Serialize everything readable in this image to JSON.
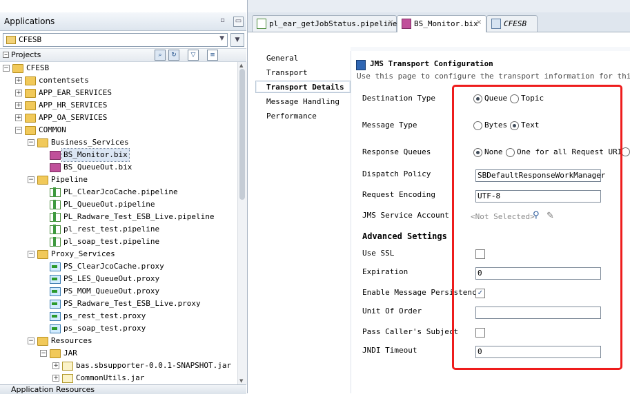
{
  "left_panel": {
    "applications_title": "Applications",
    "minimize_glyph": "▭",
    "app_selector_value": "CFESB",
    "projects_title": "Projects",
    "tree": [
      {
        "label": "CFESB",
        "level": 0,
        "type": "folder",
        "expander": "−"
      },
      {
        "label": "contentsets",
        "level": 1,
        "type": "folder",
        "expander": "+"
      },
      {
        "label": "APP_EAR_SERVICES",
        "level": 1,
        "type": "folder",
        "expander": "+"
      },
      {
        "label": "APP_HR_SERVICES",
        "level": 1,
        "type": "folder",
        "expander": "+"
      },
      {
        "label": "APP_OA_SERVICES",
        "level": 1,
        "type": "folder",
        "expander": "+"
      },
      {
        "label": "COMMON",
        "level": 1,
        "type": "folder",
        "expander": "−"
      },
      {
        "label": "Business_Services",
        "level": 2,
        "type": "folder",
        "expander": "−"
      },
      {
        "label": "BS_Monitor.bix",
        "level": 3,
        "type": "biz",
        "selected": true
      },
      {
        "label": "BS_QueueOut.bix",
        "level": 3,
        "type": "biz"
      },
      {
        "label": "Pipeline",
        "level": 2,
        "type": "folder",
        "expander": "−"
      },
      {
        "label": "PL_ClearJcoCache.pipeline",
        "level": 3,
        "type": "pipe"
      },
      {
        "label": "PL_QueueOut.pipeline",
        "level": 3,
        "type": "pipe"
      },
      {
        "label": "PL_Radware_Test_ESB_Live.pipeline",
        "level": 3,
        "type": "pipe"
      },
      {
        "label": "pl_rest_test.pipeline",
        "level": 3,
        "type": "pipe"
      },
      {
        "label": "pl_soap_test.pipeline",
        "level": 3,
        "type": "pipe"
      },
      {
        "label": "Proxy_Services",
        "level": 2,
        "type": "folder",
        "expander": "−"
      },
      {
        "label": "PS_ClearJcoCache.proxy",
        "level": 3,
        "type": "proxy"
      },
      {
        "label": "PS_LES_QueueOut.proxy",
        "level": 3,
        "type": "proxy"
      },
      {
        "label": "PS_MOM_QueueOut.proxy",
        "level": 3,
        "type": "proxy"
      },
      {
        "label": "PS_Radware_Test_ESB_Live.proxy",
        "level": 3,
        "type": "proxy"
      },
      {
        "label": "ps_rest_test.proxy",
        "level": 3,
        "type": "proxy"
      },
      {
        "label": "ps_soap_test.proxy",
        "level": 3,
        "type": "proxy"
      },
      {
        "label": "Resources",
        "level": 2,
        "type": "folder",
        "expander": "−"
      },
      {
        "label": "JAR",
        "level": 3,
        "type": "folder",
        "expander": "−"
      },
      {
        "label": "bas.sbsupporter-0.0.1-SNAPSHOT.jar",
        "level": 4,
        "type": "jar",
        "expander": "+"
      },
      {
        "label": "CommonUtils.jar",
        "level": 4,
        "type": "jar",
        "expander": "+"
      }
    ],
    "application_resources_title": "Application Resources"
  },
  "tabs": [
    {
      "label": "pl_ear_getJobStatus.pipeline",
      "active": false
    },
    {
      "label": "BS_Monitor.bix",
      "active": true
    },
    {
      "label": "CFESB",
      "active": false,
      "italic": true
    }
  ],
  "nav": {
    "items": [
      "General",
      "Transport",
      "Transport Details",
      "Message Handling",
      "Performance"
    ],
    "active": "Transport Details"
  },
  "config": {
    "title": "JMS Transport Configuration",
    "subtitle": "Use this page to configure the transport information for this serv",
    "destination_type_label": "Destination Type",
    "destination_queue": "Queue",
    "destination_topic": "Topic",
    "message_type_label": "Message Type",
    "message_bytes": "Bytes",
    "message_text": "Text",
    "response_queues_label": "Response Queues",
    "response_none": "None",
    "response_one_for_all": "One for all Request URIs",
    "dispatch_policy_label": "Dispatch Policy",
    "dispatch_policy_value": "SBDefaultResponseWorkManager",
    "request_encoding_label": "Request Encoding",
    "request_encoding_value": "UTF-8",
    "jms_service_account_label": "JMS Service Account",
    "jms_service_account_value": "<Not Selected>",
    "advanced_settings_title": "Advanced Settings",
    "use_ssl_label": "Use SSL",
    "use_ssl_checked": false,
    "expiration_label": "Expiration",
    "expiration_value": "0",
    "enable_persistence_label": "Enable Message Persistence",
    "enable_persistence_checked": true,
    "unit_of_order_label": "Unit Of Order",
    "unit_of_order_value": "",
    "pass_caller_subject_label": "Pass Caller's Subject",
    "pass_caller_subject_checked": false,
    "jndi_timeout_label": "JNDI Timeout",
    "jndi_timeout_value": "0"
  },
  "highlight_color": "#ee1c1c"
}
